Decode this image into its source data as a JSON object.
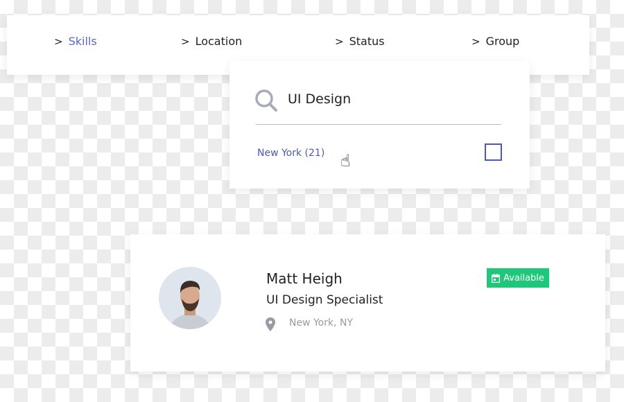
{
  "filters": {
    "tabs": [
      {
        "label": "Skills",
        "active": true
      },
      {
        "label": "Location"
      },
      {
        "label": "Status"
      },
      {
        "label": "Group"
      }
    ]
  },
  "dropdown": {
    "search_value": "UI Design",
    "option_label": "New York (21)",
    "option_checked": false
  },
  "profile": {
    "name": "Matt Heigh",
    "title": "UI Design Specialist",
    "location": "New York, NY",
    "status": "Available"
  },
  "colors": {
    "accent": "#5a67c8",
    "available": "#1fc77a"
  }
}
